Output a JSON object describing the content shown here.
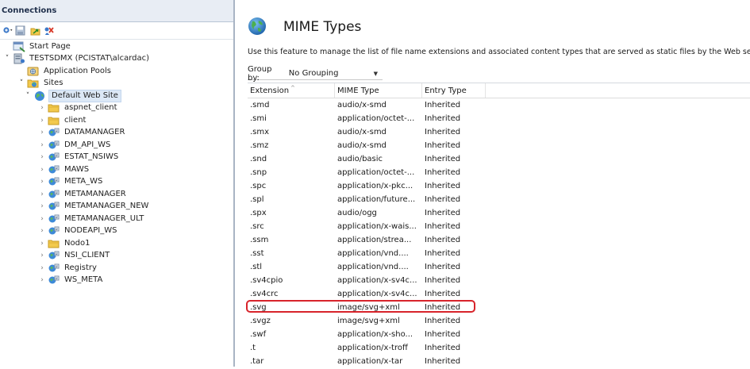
{
  "connections": {
    "title": "Connections"
  },
  "tree": [
    {
      "label": "Start Page",
      "icon": "start-page-icon",
      "depth": 0,
      "twisty": ""
    },
    {
      "label": "TESTSDMX (PCISTAT\\alcardac)",
      "icon": "server-icon",
      "depth": 0,
      "twisty": "open"
    },
    {
      "label": "Application Pools",
      "icon": "app-pool-icon",
      "depth": 1,
      "twisty": ""
    },
    {
      "label": "Sites",
      "icon": "sites-folder-icon",
      "depth": 1,
      "twisty": "open"
    },
    {
      "label": "Default Web Site",
      "icon": "website-globe-icon",
      "depth": 2,
      "twisty": "open",
      "selected": true
    },
    {
      "label": "aspnet_client",
      "icon": "folder-icon",
      "depth": 3,
      "twisty": "closed"
    },
    {
      "label": "client",
      "icon": "folder-icon",
      "depth": 3,
      "twisty": "closed"
    },
    {
      "label": "DATAMANAGER",
      "icon": "web-app-icon",
      "depth": 3,
      "twisty": "closed"
    },
    {
      "label": "DM_API_WS",
      "icon": "web-app-icon",
      "depth": 3,
      "twisty": "closed"
    },
    {
      "label": "ESTAT_NSIWS",
      "icon": "web-app-icon",
      "depth": 3,
      "twisty": "closed"
    },
    {
      "label": "MAWS",
      "icon": "web-app-icon",
      "depth": 3,
      "twisty": "closed"
    },
    {
      "label": "META_WS",
      "icon": "web-app-icon",
      "depth": 3,
      "twisty": "closed"
    },
    {
      "label": "METAMANAGER",
      "icon": "web-app-icon",
      "depth": 3,
      "twisty": "closed"
    },
    {
      "label": "METAMANAGER_NEW",
      "icon": "web-app-icon",
      "depth": 3,
      "twisty": "closed"
    },
    {
      "label": "METAMANAGER_ULT",
      "icon": "web-app-icon",
      "depth": 3,
      "twisty": "closed"
    },
    {
      "label": "NODEAPI_WS",
      "icon": "web-app-icon",
      "depth": 3,
      "twisty": "closed"
    },
    {
      "label": "Nodo1",
      "icon": "folder-icon",
      "depth": 3,
      "twisty": "closed"
    },
    {
      "label": "NSI_CLIENT",
      "icon": "web-app-icon",
      "depth": 3,
      "twisty": "closed"
    },
    {
      "label": "Registry",
      "icon": "web-app-icon",
      "depth": 3,
      "twisty": "closed"
    },
    {
      "label": "WS_META",
      "icon": "web-app-icon",
      "depth": 3,
      "twisty": "closed"
    }
  ],
  "content": {
    "title": "MIME Types",
    "description": "Use this feature to manage the list of file name extensions and associated content types that are served as static files by the Web server",
    "group_by_label": "Group by:",
    "group_by_value": "No Grouping"
  },
  "grid": {
    "headers": [
      "Extension",
      "MIME Type",
      "Entry Type"
    ],
    "rows": [
      [
        ".smd",
        "audio/x-smd",
        "Inherited"
      ],
      [
        ".smi",
        "application/octet-...",
        "Inherited"
      ],
      [
        ".smx",
        "audio/x-smd",
        "Inherited"
      ],
      [
        ".smz",
        "audio/x-smd",
        "Inherited"
      ],
      [
        ".snd",
        "audio/basic",
        "Inherited"
      ],
      [
        ".snp",
        "application/octet-...",
        "Inherited"
      ],
      [
        ".spc",
        "application/x-pkc...",
        "Inherited"
      ],
      [
        ".spl",
        "application/future...",
        "Inherited"
      ],
      [
        ".spx",
        "audio/ogg",
        "Inherited"
      ],
      [
        ".src",
        "application/x-wais...",
        "Inherited"
      ],
      [
        ".ssm",
        "application/strea...",
        "Inherited"
      ],
      [
        ".sst",
        "application/vnd....",
        "Inherited"
      ],
      [
        ".stl",
        "application/vnd....",
        "Inherited"
      ],
      [
        ".sv4cpio",
        "application/x-sv4c...",
        "Inherited"
      ],
      [
        ".sv4crc",
        "application/x-sv4c...",
        "Inherited"
      ],
      [
        ".svg",
        "image/svg+xml",
        "Inherited"
      ],
      [
        ".svgz",
        "image/svg+xml",
        "Inherited"
      ],
      [
        ".swf",
        "application/x-sho...",
        "Inherited"
      ],
      [
        ".t",
        "application/x-troff",
        "Inherited"
      ],
      [
        ".tar",
        "application/x-tar",
        "Inherited"
      ]
    ],
    "highlighted_extension": ".svg",
    "highlight_color": "#d8242b"
  }
}
